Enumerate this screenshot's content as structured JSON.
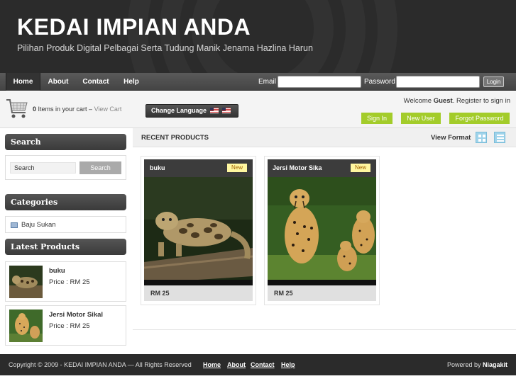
{
  "header": {
    "title": "KEDAI IMPIAN ANDA",
    "tagline": "Pilihan Produk Digital Pelbagai Serta Tudung Manik Jenama Hazlina Harun"
  },
  "nav": {
    "items": [
      "Home",
      "About",
      "Contact",
      "Help"
    ],
    "email_label": "Email",
    "password_label": "Password",
    "login_label": "Login"
  },
  "cart": {
    "count": "0",
    "text": "Items in your cart –",
    "link": "View Cart"
  },
  "language": {
    "label": "Change Language"
  },
  "account": {
    "welcome_prefix": "Welcome",
    "guest": "Guest",
    "welcome_suffix": ". Register to sign in",
    "sign_in": "Sign In",
    "new_user": "New User",
    "forgot": "Forgot Password"
  },
  "sidebar": {
    "search_title": "Search",
    "search_value": "Search",
    "search_button": "Search",
    "categories_title": "Categories",
    "categories": [
      "Baju Sukan"
    ],
    "latest_title": "Latest Products",
    "latest": [
      {
        "name": "buku",
        "price": "Price : RM  25"
      },
      {
        "name": "Jersi Motor Sikal",
        "price": "Price : RM  25"
      }
    ]
  },
  "main": {
    "title": "RECENT PRODUCTS",
    "view_format": "View Format",
    "products": [
      {
        "name": "buku",
        "badge": "New",
        "price": "RM 25"
      },
      {
        "name": "Jersi Motor Sika",
        "badge": "New",
        "price": "RM 25"
      }
    ]
  },
  "footer": {
    "copyright": "Copyright © 2009 - KEDAI IMPIAN ANDA — All Rights Reserved",
    "links": [
      "Home",
      "About",
      "Contact",
      "Help"
    ],
    "powered_prefix": "Powered by",
    "powered_by": "Niagakit"
  }
}
